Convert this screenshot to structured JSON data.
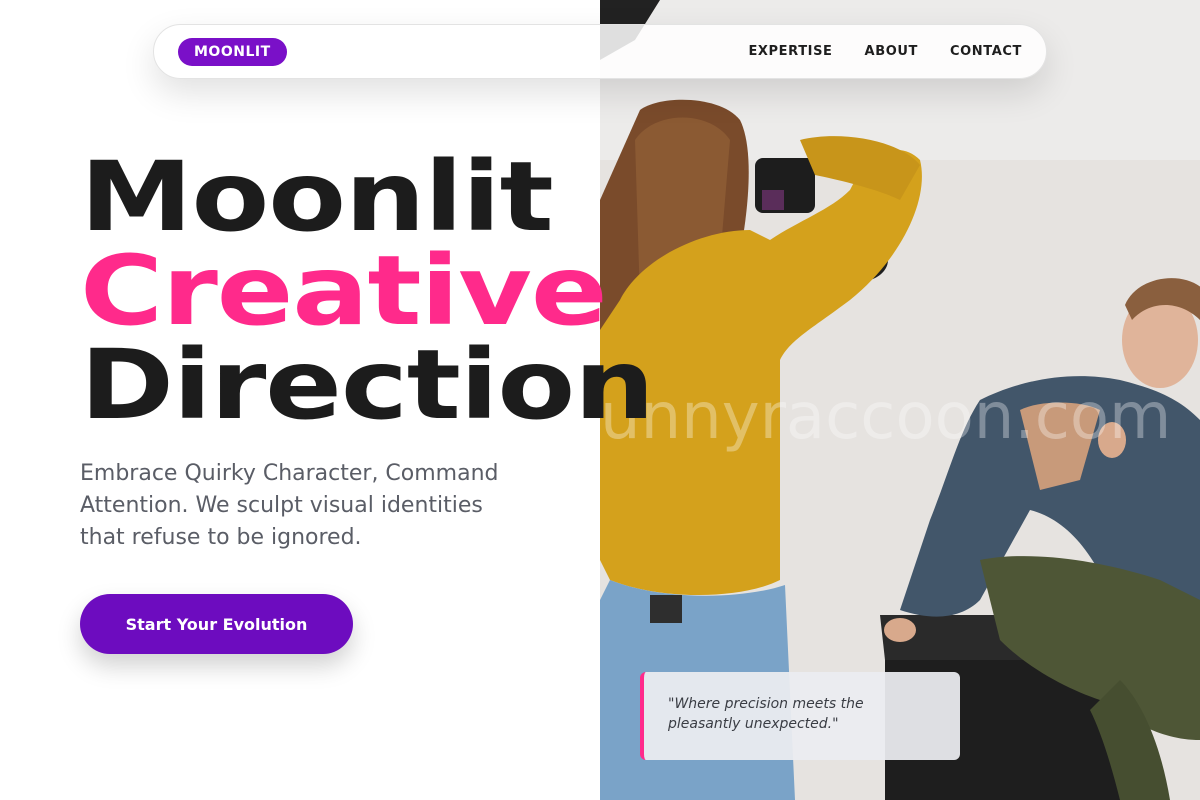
{
  "brand": {
    "logo_text": "MOONLIT",
    "accent": "#7a10c8",
    "highlight": "#ff2a8b"
  },
  "nav": {
    "links": [
      {
        "label": "EXPERTISE"
      },
      {
        "label": "ABOUT"
      },
      {
        "label": "CONTACT"
      }
    ]
  },
  "hero": {
    "headline": {
      "line1": "Moonlit",
      "line2": "Creative",
      "line3": "Direction"
    },
    "subtext": "Embrace Quirky Character, Command Attention. We sculpt visual identities that refuse to be ignored.",
    "cta_label": "Start Your Evolution"
  },
  "photo": {
    "watermark": "unnyraccoon.com",
    "subject": "photographer-shooting-model"
  },
  "quote": {
    "text": "\"Where precision meets the pleasantly unexpected.\""
  }
}
